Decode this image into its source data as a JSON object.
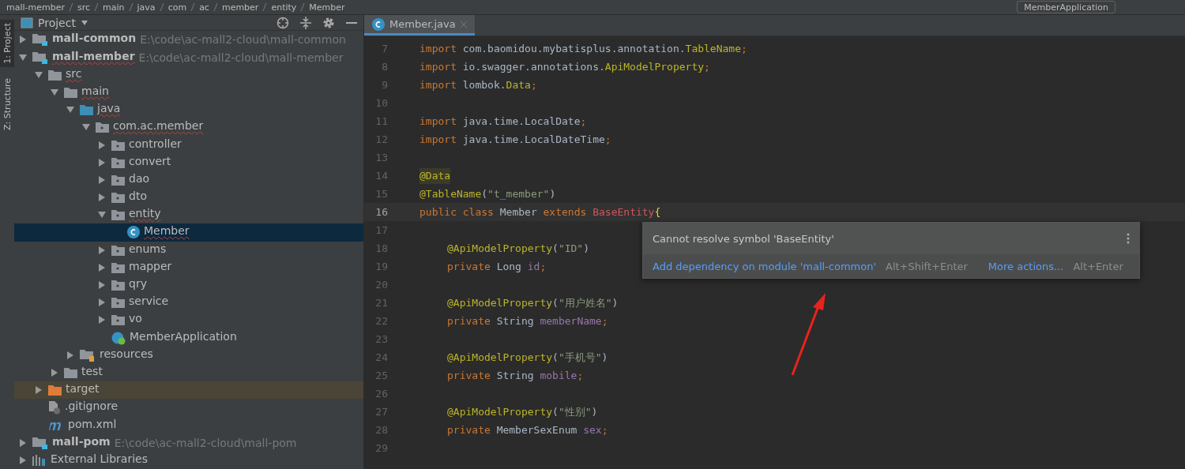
{
  "navbar": {
    "breadcrumbs": [
      "mall-member",
      "src",
      "main",
      "java",
      "com",
      "ac",
      "member",
      "entity",
      "Member"
    ],
    "run_config": "MemberApplication"
  },
  "side_tabs": [
    {
      "label": "1: Project",
      "selected": true
    },
    {
      "label": "Z: Structure",
      "selected": false
    }
  ],
  "project_panel": {
    "title": "Project",
    "tree": [
      {
        "kind": "module",
        "label": "mall-common",
        "path": "E:\\code\\ac-mall2-cloud\\mall-common",
        "expanded": false,
        "selected": false,
        "flagged": false
      },
      {
        "kind": "module",
        "label": "mall-member",
        "path": "E:\\code\\ac-mall2-cloud\\mall-member",
        "expanded": true,
        "selected": false,
        "flagged": true,
        "children": [
          {
            "kind": "folder",
            "label": "src",
            "expanded": true,
            "selected": false,
            "flagged": true,
            "children": [
              {
                "kind": "folder",
                "label": "main",
                "expanded": true,
                "selected": false,
                "flagged": true,
                "children": [
                  {
                    "kind": "source",
                    "label": "java",
                    "expanded": true,
                    "selected": false,
                    "flagged": true,
                    "children": [
                      {
                        "kind": "package",
                        "label": "com.ac.member",
                        "expanded": true,
                        "selected": false,
                        "flagged": true,
                        "children": [
                          {
                            "kind": "package",
                            "label": "controller",
                            "expanded": false,
                            "selected": false,
                            "flagged": false
                          },
                          {
                            "kind": "package",
                            "label": "convert",
                            "expanded": false,
                            "selected": false,
                            "flagged": false
                          },
                          {
                            "kind": "package",
                            "label": "dao",
                            "expanded": false,
                            "selected": false,
                            "flagged": false
                          },
                          {
                            "kind": "package",
                            "label": "dto",
                            "expanded": false,
                            "selected": false,
                            "flagged": false
                          },
                          {
                            "kind": "package",
                            "label": "entity",
                            "expanded": true,
                            "selected": false,
                            "flagged": true,
                            "children": [
                              {
                                "kind": "class",
                                "label": "Member",
                                "selected": true,
                                "flagged": true
                              }
                            ]
                          },
                          {
                            "kind": "package",
                            "label": "enums",
                            "expanded": false,
                            "selected": false,
                            "flagged": false
                          },
                          {
                            "kind": "package",
                            "label": "mapper",
                            "expanded": false,
                            "selected": false,
                            "flagged": false
                          },
                          {
                            "kind": "package",
                            "label": "qry",
                            "expanded": false,
                            "selected": false,
                            "flagged": false
                          },
                          {
                            "kind": "package",
                            "label": "service",
                            "expanded": false,
                            "selected": false,
                            "flagged": false
                          },
                          {
                            "kind": "package",
                            "label": "vo",
                            "expanded": false,
                            "selected": false,
                            "flagged": false
                          },
                          {
                            "kind": "app",
                            "label": "MemberApplication",
                            "selected": false,
                            "flagged": false
                          }
                        ]
                      }
                    ]
                  },
                  {
                    "kind": "resources",
                    "label": "resources",
                    "expanded": false,
                    "selected": false,
                    "flagged": false
                  }
                ]
              },
              {
                "kind": "folder",
                "label": "test",
                "expanded": false,
                "selected": false,
                "flagged": false
              }
            ]
          },
          {
            "kind": "excluded",
            "label": "target",
            "expanded": false,
            "selected": false,
            "flagged": false
          },
          {
            "kind": "ignore",
            "label": ".gitignore",
            "selected": false,
            "flagged": false
          },
          {
            "kind": "maven",
            "label": "pom.xml",
            "selected": false,
            "flagged": false
          }
        ]
      },
      {
        "kind": "module",
        "label": "mall-pom",
        "path": "E:\\code\\ac-mall2-cloud\\mall-pom",
        "expanded": false,
        "selected": false,
        "flagged": false
      },
      {
        "kind": "library",
        "label": "External Libraries",
        "expanded": false,
        "selected": false,
        "flagged": false
      }
    ]
  },
  "editor": {
    "tabs": [
      {
        "label": "Member.java",
        "selected": true
      }
    ],
    "lines": [
      {
        "number": "7",
        "current": false,
        "indented": false,
        "tokens": [
          {
            "kind": "kw",
            "t": "import "
          },
          {
            "kind": "plain",
            "t": "com.baomidou.mybatisplus.annotation."
          },
          {
            "kind": "type",
            "t": "TableName"
          },
          {
            "kind": "kw",
            "t": ";"
          }
        ]
      },
      {
        "number": "8",
        "current": false,
        "indented": false,
        "tokens": [
          {
            "kind": "kw",
            "t": "import "
          },
          {
            "kind": "plain",
            "t": "io.swagger.annotations."
          },
          {
            "kind": "type",
            "t": "ApiModelProperty"
          },
          {
            "kind": "kw",
            "t": ";"
          }
        ]
      },
      {
        "number": "9",
        "current": false,
        "indented": false,
        "tokens": [
          {
            "kind": "kw",
            "t": "import "
          },
          {
            "kind": "plain",
            "t": "lombok."
          },
          {
            "kind": "type",
            "t": "Data"
          },
          {
            "kind": "kw",
            "t": ";"
          }
        ]
      },
      {
        "number": "10",
        "current": false
      },
      {
        "number": "11",
        "current": false,
        "indented": false,
        "tokens": [
          {
            "kind": "kw",
            "t": "import "
          },
          {
            "kind": "plain",
            "t": "java.time.LocalDate"
          },
          {
            "kind": "kw",
            "t": ";"
          }
        ]
      },
      {
        "number": "12",
        "current": false,
        "indented": false,
        "tokens": [
          {
            "kind": "kw",
            "t": "import "
          },
          {
            "kind": "plain",
            "t": "java.time.LocalDateTime"
          },
          {
            "kind": "kw",
            "t": ";"
          }
        ]
      },
      {
        "number": "13",
        "current": false
      },
      {
        "number": "14",
        "current": false,
        "indented": false,
        "tokens": [
          {
            "kind": "marked",
            "t": "@Data"
          }
        ]
      },
      {
        "number": "15",
        "current": false,
        "indented": false,
        "tokens": [
          {
            "kind": "ann",
            "t": "@TableName"
          },
          {
            "kind": "plain",
            "t": "("
          },
          {
            "kind": "str",
            "t": "\"t_member\""
          },
          {
            "kind": "plain",
            "t": ")"
          }
        ]
      },
      {
        "number": "16",
        "current": true,
        "indented": false,
        "tokens": [
          {
            "kind": "kw",
            "t": "public class "
          },
          {
            "kind": "plain",
            "t": "Member "
          },
          {
            "kind": "kw",
            "t": "extends "
          },
          {
            "kind": "err",
            "t": "BaseEntity"
          },
          {
            "kind": "brace",
            "t": "{"
          }
        ]
      },
      {
        "number": "17",
        "current": false
      },
      {
        "number": "18",
        "current": false,
        "indented": true,
        "tokens": [
          {
            "kind": "ann",
            "t": "@ApiModelProperty"
          },
          {
            "kind": "plain",
            "t": "("
          },
          {
            "kind": "str",
            "t": "\"ID\""
          },
          {
            "kind": "plain",
            "t": ")"
          }
        ]
      },
      {
        "number": "19",
        "current": false,
        "indented": true,
        "tokens": [
          {
            "kind": "kw",
            "t": "private "
          },
          {
            "kind": "plain",
            "t": "Long "
          },
          {
            "kind": "field",
            "t": "id"
          },
          {
            "kind": "kw",
            "t": ";"
          }
        ]
      },
      {
        "number": "20",
        "current": false
      },
      {
        "number": "21",
        "current": false,
        "indented": true,
        "tokens": [
          {
            "kind": "ann",
            "t": "@ApiModelProperty"
          },
          {
            "kind": "plain",
            "t": "("
          },
          {
            "kind": "str",
            "t": "\"用户姓名\""
          },
          {
            "kind": "plain",
            "t": ")"
          }
        ]
      },
      {
        "number": "22",
        "current": false,
        "indented": true,
        "tokens": [
          {
            "kind": "kw",
            "t": "private "
          },
          {
            "kind": "plain",
            "t": "String "
          },
          {
            "kind": "field",
            "t": "memberName"
          },
          {
            "kind": "kw",
            "t": ";"
          }
        ]
      },
      {
        "number": "23",
        "current": false
      },
      {
        "number": "24",
        "current": false,
        "indented": true,
        "tokens": [
          {
            "kind": "ann",
            "t": "@ApiModelProperty"
          },
          {
            "kind": "plain",
            "t": "("
          },
          {
            "kind": "str",
            "t": "\"手机号\""
          },
          {
            "kind": "plain",
            "t": ")"
          }
        ]
      },
      {
        "number": "25",
        "current": false,
        "indented": true,
        "tokens": [
          {
            "kind": "kw",
            "t": "private "
          },
          {
            "kind": "plain",
            "t": "String "
          },
          {
            "kind": "field",
            "t": "mobile"
          },
          {
            "kind": "kw",
            "t": ";"
          }
        ]
      },
      {
        "number": "26",
        "current": false
      },
      {
        "number": "27",
        "current": false,
        "indented": true,
        "tokens": [
          {
            "kind": "ann",
            "t": "@ApiModelProperty"
          },
          {
            "kind": "plain",
            "t": "("
          },
          {
            "kind": "str",
            "t": "\"性别\""
          },
          {
            "kind": "plain",
            "t": ")"
          }
        ]
      },
      {
        "number": "28",
        "current": false,
        "indented": true,
        "tokens": [
          {
            "kind": "kw",
            "t": "private "
          },
          {
            "kind": "plain",
            "t": "MemberSexEnum "
          },
          {
            "kind": "field",
            "t": "sex"
          },
          {
            "kind": "kw",
            "t": ";"
          }
        ]
      },
      {
        "number": "29",
        "current": false
      }
    ],
    "popup": {
      "message": "Cannot resolve symbol 'BaseEntity'",
      "actions": [
        {
          "label": "Add dependency on module 'mall-common'",
          "shortcut": "Alt+Shift+Enter"
        },
        {
          "label": "More actions...",
          "shortcut": "Alt+Enter"
        }
      ]
    }
  }
}
